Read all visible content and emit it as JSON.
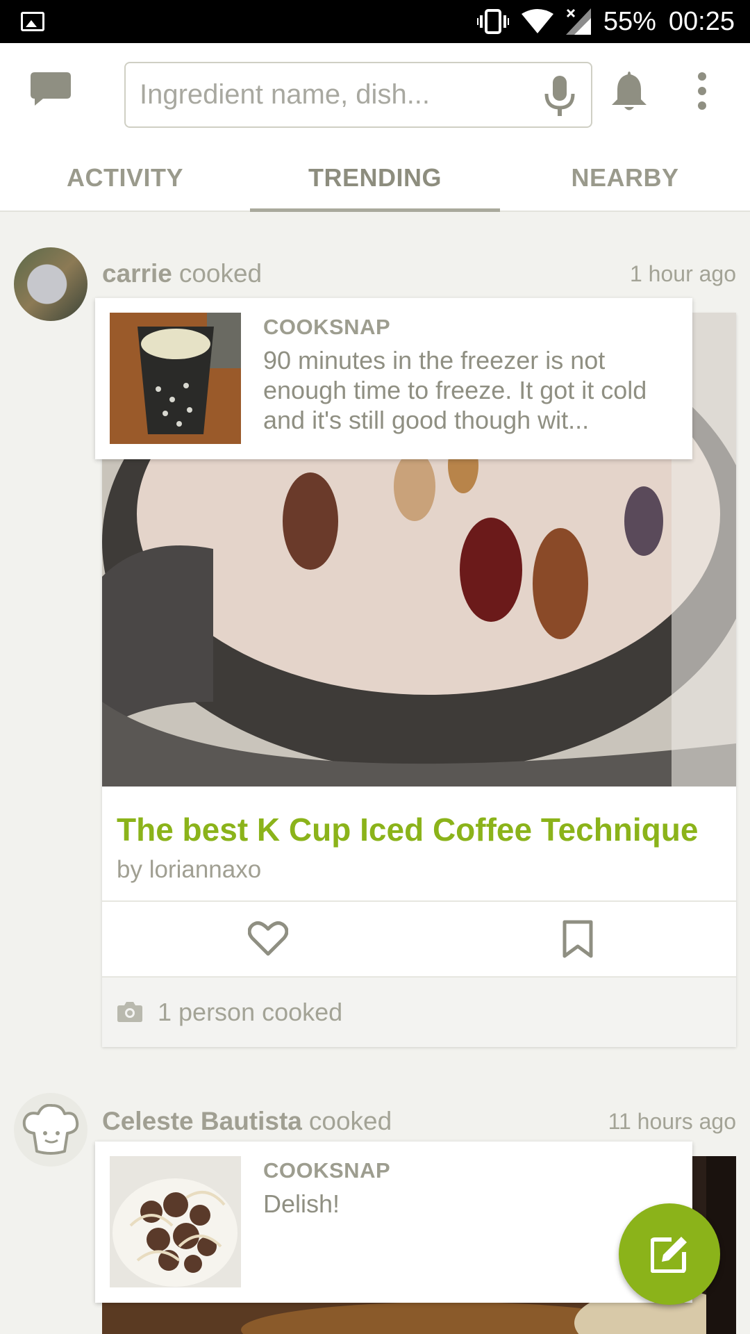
{
  "status_bar": {
    "battery": "55%",
    "time": "00:25"
  },
  "search": {
    "placeholder": "Ingredient name, dish..."
  },
  "tabs": [
    {
      "label": "ACTIVITY"
    },
    {
      "label": "TRENDING"
    },
    {
      "label": "NEARBY"
    }
  ],
  "active_tab": "TRENDING",
  "feed": [
    {
      "user": "carrie",
      "action": "cooked",
      "time": "1 hour ago",
      "cooksnap": {
        "label": "COOKSNAP",
        "text": "90 minutes in the freezer is not enough time to freeze. It got it cold and it's still good though wit..."
      },
      "recipe": {
        "title": "The best K Cup Iced Coffee Technique",
        "author": "by loriannaxo"
      },
      "cooked_count": "1 person cooked"
    },
    {
      "user": "Celeste Bautista",
      "action": "cooked",
      "time": "11 hours ago",
      "cooksnap": {
        "label": "COOKSNAP",
        "text": "Delish!"
      }
    }
  ],
  "colors": {
    "accent": "#8bb31a",
    "muted_text": "#a3a396",
    "background": "#f2f2ee"
  },
  "icons": [
    "image-icon",
    "vibrate-icon",
    "wifi-icon",
    "signal-icon",
    "chat-icon",
    "mic-icon",
    "bell-icon",
    "more-vert-icon",
    "heart-icon",
    "bookmark-icon",
    "camera-icon",
    "edit-icon",
    "chef-hat-icon"
  ]
}
